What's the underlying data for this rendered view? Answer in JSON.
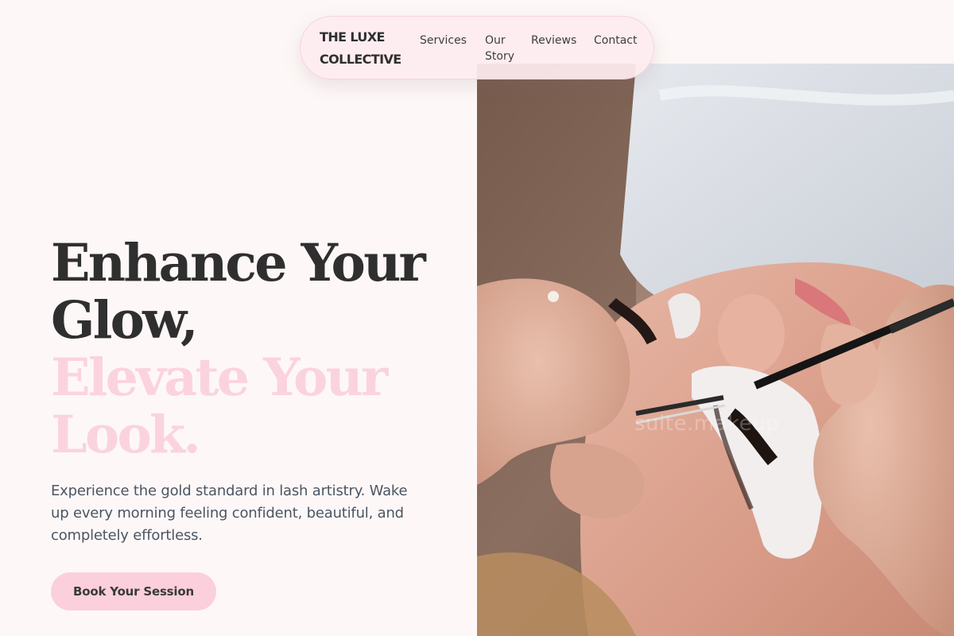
{
  "nav": {
    "brand_line1": "THE LUXE",
    "brand_line2": "COLLECTIVE",
    "links": [
      "Services",
      "Our Story",
      "Reviews",
      "Contact"
    ]
  },
  "hero": {
    "title_line1": "Enhance Your",
    "title_line2": "Glow,",
    "title_line3": "Elevate Your",
    "title_line4": "Look.",
    "description": "Experience the gold standard in lash artistry. Wake up every morning feeling confident, beautiful, and completely effortless.",
    "cta_label": "Book Your Session"
  },
  "image": {
    "watermark": "suite.makeup"
  },
  "colors": {
    "background": "#fdf8f7",
    "text_dark": "#2f2f2f",
    "accent_pink": "#fbd3de",
    "button_pink": "#fbd0dc",
    "body_gray": "#4c5563"
  }
}
